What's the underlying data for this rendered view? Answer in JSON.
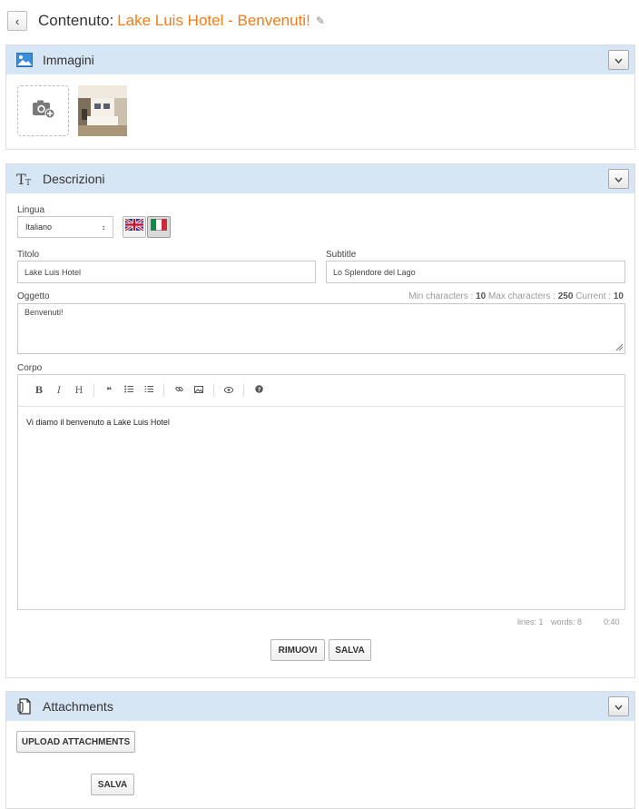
{
  "header": {
    "prefix": "Contenuto:",
    "content_name": "Lake Luis Hotel - Benvenuti!"
  },
  "images_panel": {
    "title": "Immagini"
  },
  "descriptions_panel": {
    "title": "Descrizioni",
    "language_label": "Lingua",
    "language_value": "Italiano",
    "title_label": "Titolo",
    "title_value": "Lake Luis Hotel",
    "subtitle_label": "Subtitle",
    "subtitle_value": "Lo Splendore del Lago",
    "subject_label": "Oggetto",
    "subject_value": "Benvenuti!",
    "counter": {
      "min_label": "Min characters :",
      "min_value": "10",
      "max_label": "Max characters :",
      "max_value": "250",
      "current_label": "Current :",
      "current_value": "10"
    },
    "body_label": "Corpo",
    "body_text": "Vi diamo il benvenuto a Lake Luis Hotel",
    "toolbar": {
      "bold": "B",
      "italic": "I",
      "heading": "H"
    },
    "status": {
      "lines": "lines: 1",
      "words": "words: 8",
      "cursor": "0:40"
    },
    "remove_button": "RIMUOVI",
    "save_button": "SALVA"
  },
  "attachments_panel": {
    "title": "Attachments",
    "upload_button": "UPLOAD ATTACHMENTS",
    "save_button": "SALVA"
  },
  "colors": {
    "accent": "#ee7d1e",
    "panel_header": "#d6e6f5"
  }
}
